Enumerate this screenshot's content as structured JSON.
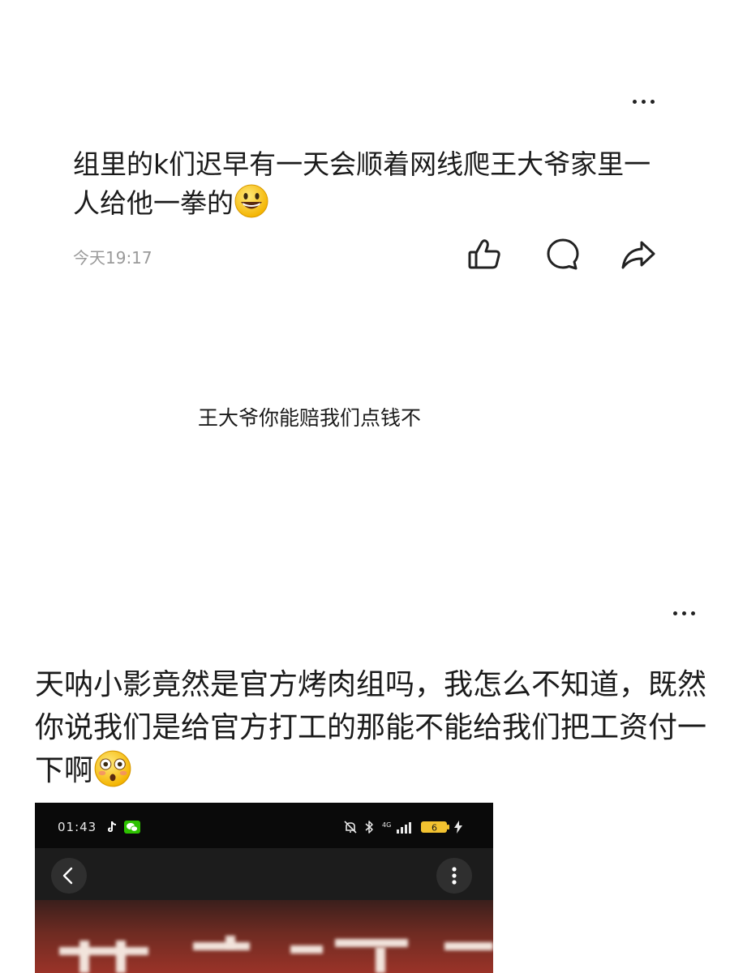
{
  "post1": {
    "text": "组里的k们迟早有一天会顺着网线爬王大爷家里一人给他一拳的",
    "emoji": "smiling-face-emoji",
    "time": "今天19:17",
    "more_icon": "more-icon",
    "actions": [
      "like-icon",
      "comment-icon",
      "share-icon"
    ]
  },
  "middle_text": "王大爷你能赔我们点钱不",
  "post2": {
    "text": "天呐小影竟然是官方烤肉组吗，我怎么不知道，既然你说我们是给官方打工的那能不能给我们把工资付一下啊",
    "emoji": "flushed-face-emoji",
    "more_icon": "more-icon",
    "screenshot": {
      "status_time": "01:43",
      "network": "4G",
      "battery": "6",
      "icons": [
        "tiktok-icon",
        "wechat-icon",
        "mute-icon",
        "bluetooth-icon",
        "signal-icon",
        "battery-icon",
        "charging-icon"
      ],
      "nav": [
        "back-icon",
        "more-vertical-icon"
      ]
    }
  },
  "colors": {
    "text": "#1b1b1b",
    "time": "#9a9a9a",
    "screenshot_bg": "#0f0f0f",
    "image_red": "#9a3328",
    "battery_yellow": "#f2c230"
  }
}
